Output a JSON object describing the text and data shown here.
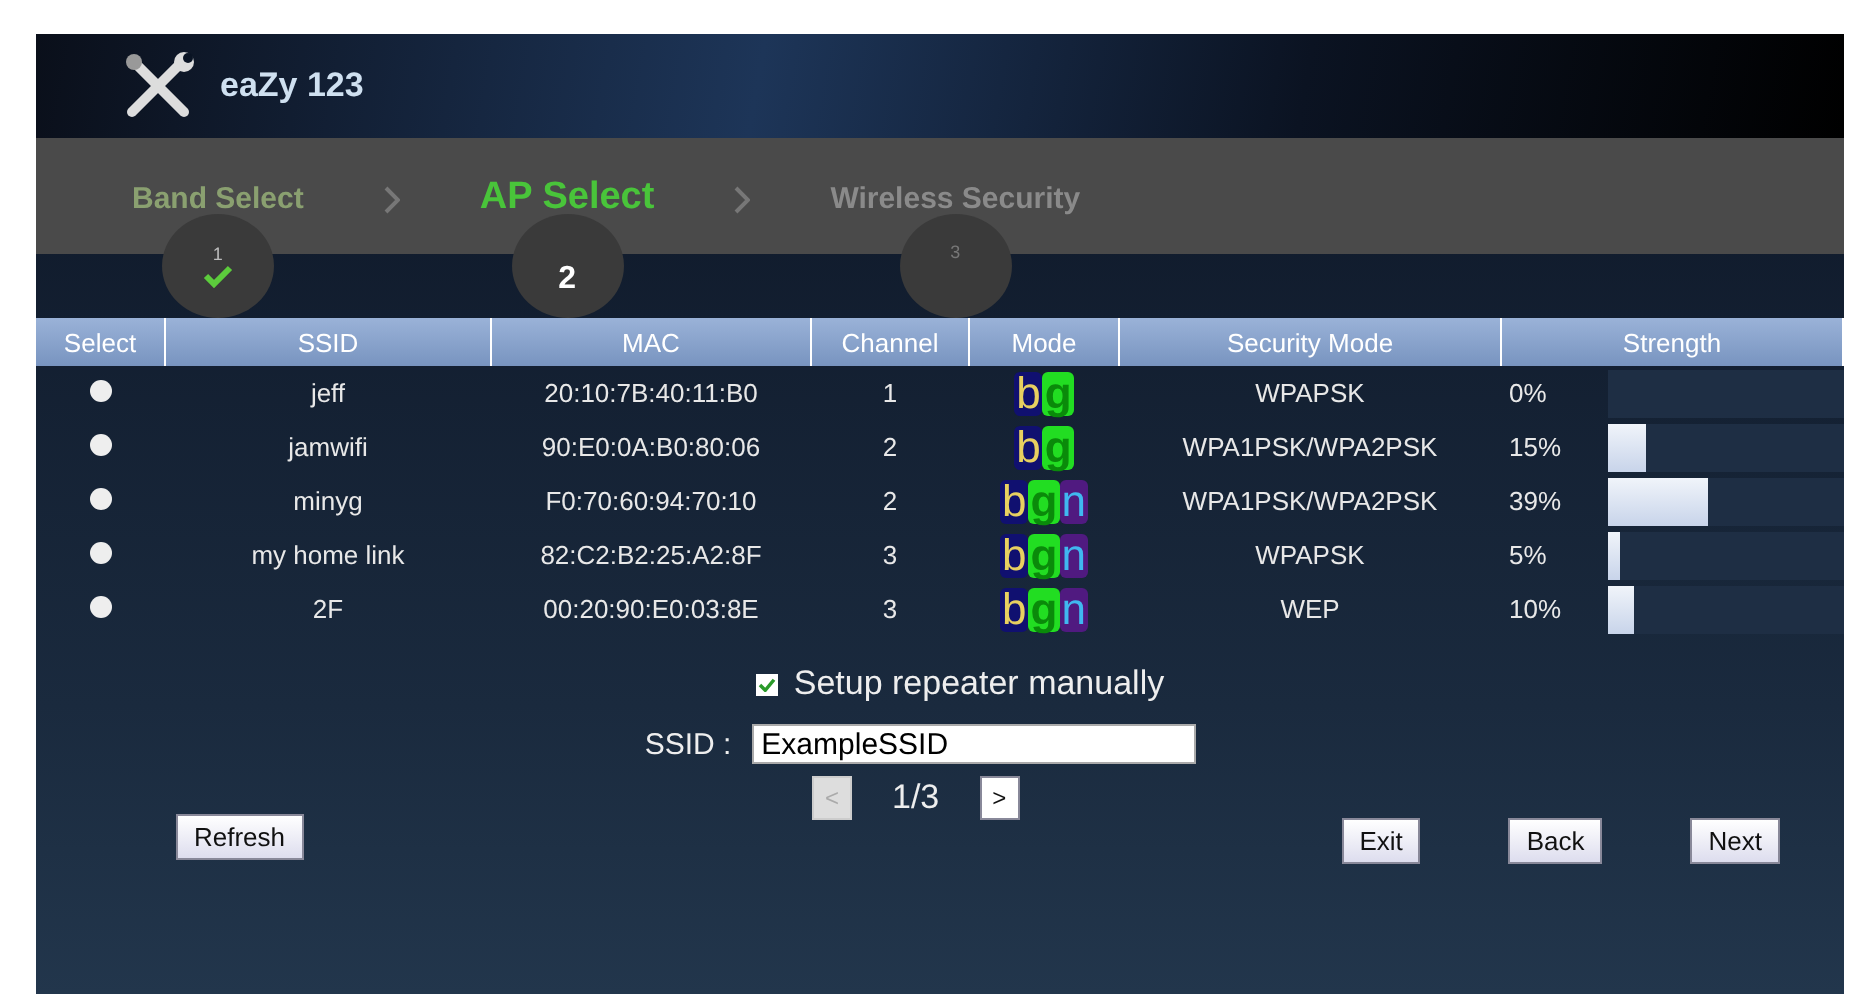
{
  "header": {
    "title": "eaZy 123"
  },
  "steps": [
    {
      "label": "Band Select",
      "number": "1",
      "done": true,
      "selected": false
    },
    {
      "label": "AP Select",
      "number": "2",
      "done": false,
      "selected": true
    },
    {
      "label": "Wireless Security",
      "number": "3",
      "done": false,
      "selected": false
    }
  ],
  "table": {
    "columns": [
      "Select",
      "SSID",
      "MAC",
      "Channel",
      "Mode",
      "Security Mode",
      "Strength"
    ],
    "rows": [
      {
        "selected": false,
        "ssid": "jeff",
        "mac": "20:10:7B:40:11:B0",
        "channel": "1",
        "mode": [
          {
            "letter": "b",
            "kind": "b"
          },
          {
            "letter": "g",
            "kind": "g"
          }
        ],
        "security": "WPAPSK",
        "strength": "0%"
      },
      {
        "selected": false,
        "ssid": "jamwifi",
        "mac": "90:E0:0A:B0:80:06",
        "channel": "2",
        "mode": [
          {
            "letter": "b",
            "kind": "b"
          },
          {
            "letter": "g",
            "kind": "g"
          }
        ],
        "security": "WPA1PSK/WPA2PSK",
        "strength": "15%",
        "level": 0.15
      },
      {
        "selected": false,
        "ssid": "minyg",
        "mac": "F0:70:60:94:70:10",
        "channel": "2",
        "mode": [
          {
            "letter": "b",
            "kind": "b"
          },
          {
            "letter": "g",
            "kind": "g"
          },
          {
            "letter": "n",
            "kind": "n"
          }
        ],
        "security": "WPA1PSK/WPA2PSK",
        "strength": "39%",
        "level": 0.39
      },
      {
        "selected": false,
        "ssid": "my home link",
        "mac": "82:C2:B2:25:A2:8F",
        "channel": "3",
        "mode": [
          {
            "letter": "b",
            "kind": "b"
          },
          {
            "letter": "g",
            "kind": "g"
          },
          {
            "letter": "n",
            "kind": "n"
          }
        ],
        "security": "WPAPSK",
        "strength": "5%",
        "level": 0.05
      },
      {
        "selected": false,
        "ssid": "2F",
        "mac": "00:20:90:E0:03:8E",
        "channel": "3",
        "mode": [
          {
            "letter": "b",
            "kind": "b"
          },
          {
            "letter": "g",
            "kind": "g"
          },
          {
            "letter": "n",
            "kind": "n"
          }
        ],
        "security": "WEP",
        "strength": "10%",
        "level": 0.1
      }
    ]
  },
  "manual": {
    "label": "Setup repeater manually",
    "checked": true
  },
  "ssid_field": {
    "label": "SSID :",
    "value": "ExampleSSID"
  },
  "pager": {
    "prev": {
      "label": "<",
      "disabled": true
    },
    "page": "1/3",
    "next": {
      "label": ">",
      "disabled": false
    }
  },
  "buttons": {
    "refresh": "Refresh",
    "exit": "Exit",
    "back": "Back",
    "next": "Next"
  }
}
